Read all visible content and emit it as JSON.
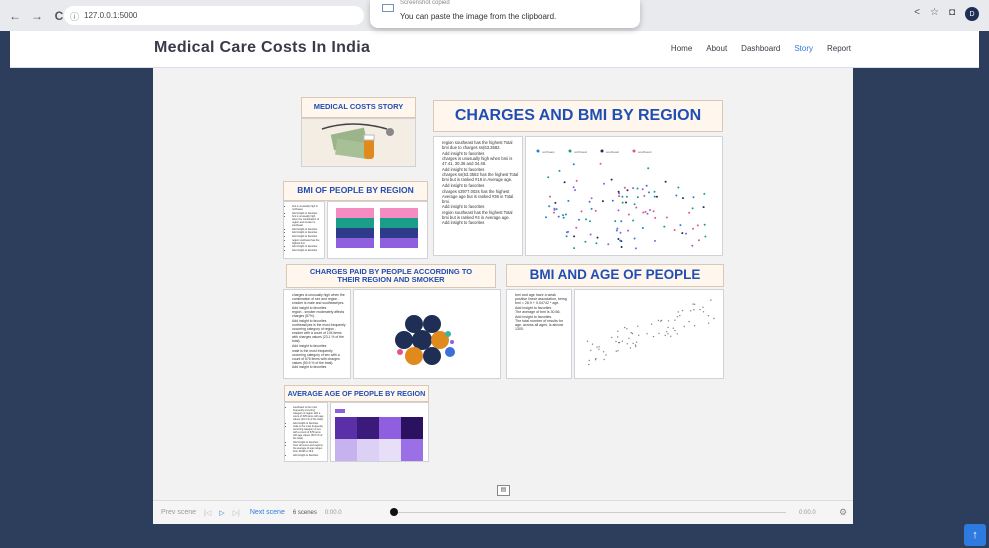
{
  "browser": {
    "url": "127.0.0.1:5000",
    "back_glyph": "←",
    "forward_glyph": "→",
    "reload_glyph": "C",
    "info_glyph": "ⓘ",
    "share_glyph": "<",
    "star_glyph": "☆",
    "tab_glyph": "◘",
    "avatar_letter": "D"
  },
  "toast": {
    "top_text": "Screenshot copied",
    "message": "You can paste the image from the clipboard."
  },
  "header": {
    "brand": "Medical Care Costs In India",
    "nav": [
      "Home",
      "About",
      "Dashboard",
      "Story",
      "Report"
    ],
    "active_nav": "Story"
  },
  "story": {
    "medical_costs_title": "MEDICAL COSTS STORY",
    "charges_bmi_title": "CHARGES AND BMI BY REGION",
    "bmi_region_title": "BMI OF PEOPLE BY REGION",
    "charges_paid_title": "CHARGES PAID BY PEOPLE ACCORDING TO THEIR REGION AND SMOKER",
    "bmi_age_title": "BMI AND AGE OF PEOPLE",
    "avg_age_title": "AVERAGE AGE OF PEOPLE BY REGION",
    "charges_bmi_bullets": [
      "region southeast has the highest Total bmi due to charges ss(63.3582.",
      "Add insight to favorites",
      "charges is unusually high when bmi is 47.41, 30.36 and 34.48.",
      "Add insight to favorites",
      "charges ss(63.3582 has the highest Total bmi but is ranked #19 in Average age.",
      "Add insight to favorites",
      "charges s3977.002s has the highest Average age but is ranked #36 in Total bmi.",
      "Add insight to favorites",
      "region southeast has the highest Total bmi but is ranked #4 in Average age.",
      "Add insight to favorites"
    ],
    "bmi_region_bullets": [
      "bmi is unusually high in northeast.",
      "Add insight to favorites",
      "bmi is unusually high when the combination of region and smoker is southeast.",
      "Add insight to favorites",
      "Add insight to favorites",
      "Add insight to favorites",
      "region southeast has the highest bmi.",
      "Add insight to favorites",
      "Add insight to favorites"
    ],
    "charges_paid_bullets": [
      "charges is unusually high when the combination of sex and region - smoker is male and southeast/yes.",
      "Add insight to favorites",
      "region - smoker moderately affects charges (87%).",
      "Add insight to favorites",
      "northeast/yes is the most frequently occurring category of region - smoker with a count of 104 items with charges values (23.1 % of the total).",
      "Add insight to favorites",
      "male is the most frequently occurring category of sex with a count of 676 items with charges values (50.5 % of the total).",
      "Add insight to favorites"
    ],
    "bmi_age_bullets": [
      "bmi and age have a weak positive linear association, being bmi = 28.9 + 0.04742 * age.",
      "Add insight to favorites",
      "The average of bmi is 30.66.",
      "Add insight to favorites",
      "The total number of results for age, across all ages, is almost 1300."
    ],
    "avg_age_bullets": [
      "southwest is the most frequently occurring category of region with a count of 325 items with age values (24.3 % of the total).",
      "Add insight to favorites",
      "male is the most frequently occurring category of sex with a count of 676 items with age values (50.5 % of the total).",
      "Add insight to favorites",
      "Over all sexes and regions, the average of age ranges from 38.98 to 39.4.",
      "Add insight to favorites"
    ],
    "legend_items": [
      "northeast",
      "northwest",
      "southeast",
      "southwest"
    ]
  },
  "playbar": {
    "prev": "Prev scene",
    "first_glyph": "|◁",
    "play_glyph": "▷",
    "last_glyph": "▷|",
    "next": "Next scene",
    "scenes": "6 scenes",
    "time_start": "0:00.0",
    "time_end": "0:00.0",
    "settings_glyph": "⚙"
  },
  "fab_glyph": "↑",
  "colors": {
    "accent": "#2e7be0",
    "title_blue": "#1f4fb4",
    "page_bg": "#2c3e5c"
  }
}
